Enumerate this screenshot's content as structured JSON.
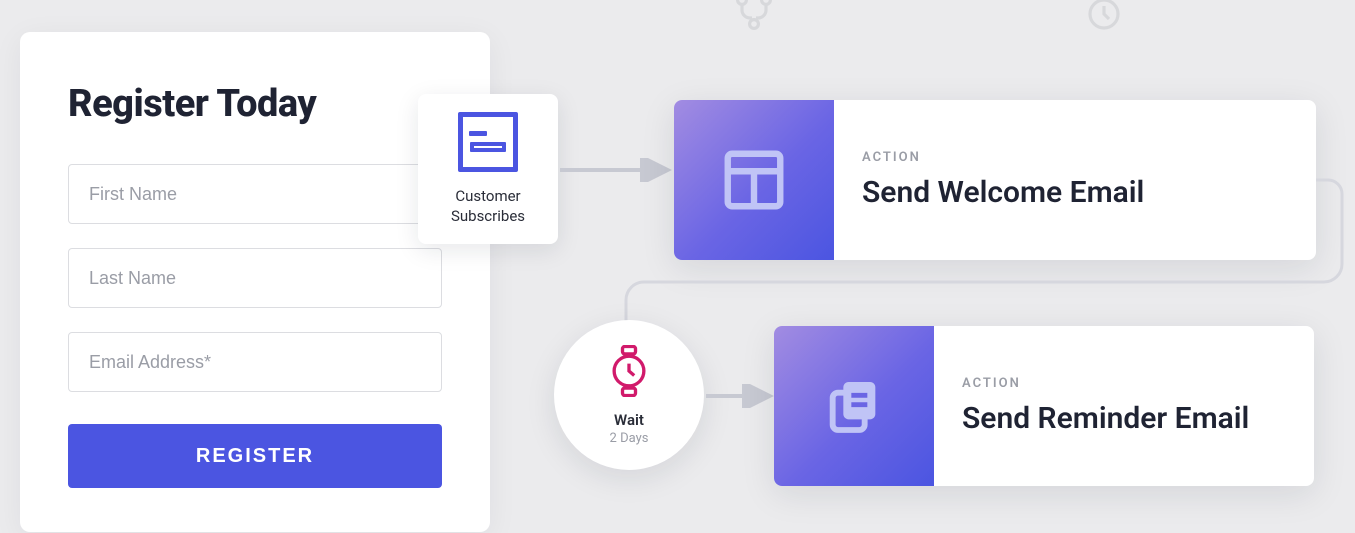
{
  "form": {
    "title": "Register Today",
    "first_name_placeholder": "First Name",
    "last_name_placeholder": "Last Name",
    "email_placeholder": "Email Address*",
    "submit_label": "REGISTER"
  },
  "trigger": {
    "label": "Customer Subscribes"
  },
  "actions": {
    "overline": "ACTION",
    "welcome": {
      "title": "Send Welcome Email"
    },
    "reminder": {
      "title": "Send Reminder Email"
    }
  },
  "wait": {
    "label": "Wait",
    "sub": "2 Days"
  },
  "colors": {
    "accent": "#4b55e1",
    "accent_gradient_start": "#a28ce2",
    "magenta": "#d11a6b"
  }
}
